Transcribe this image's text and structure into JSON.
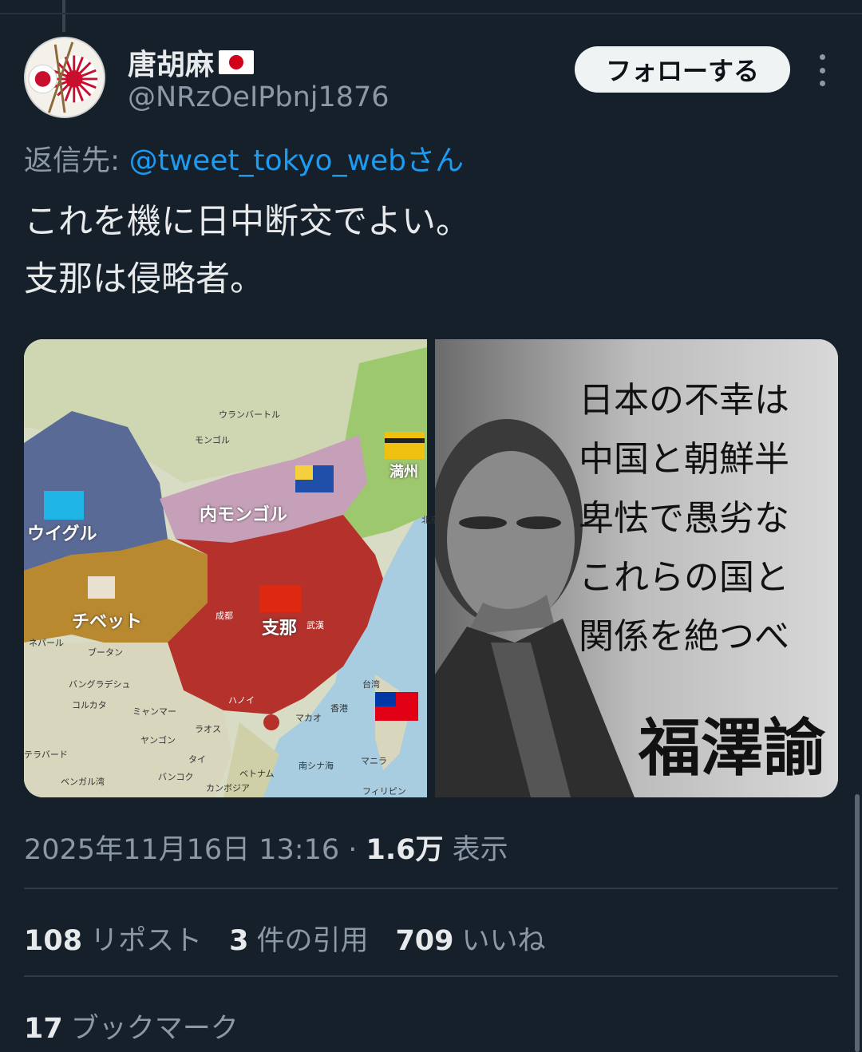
{
  "author": {
    "display_name": "唐胡麻",
    "handle": "@NRzOeIPbnj1876",
    "flag_emoji": "japan-flag"
  },
  "follow_button": {
    "label": "フォローする"
  },
  "reply_to": {
    "prefix": "返信先: ",
    "mention": "@tweet_tokyo_web",
    "suffix": "さん"
  },
  "tweet": {
    "lines": [
      "これを機に日中断交でよい。",
      "支那は侵略者。"
    ]
  },
  "media": {
    "map": {
      "labels": {
        "ulaanbaatar": "ウランバートル",
        "mongolia": "モンゴル",
        "inner_mongolia": "内モンゴル",
        "manchuria": "満州",
        "uyghur": "ウイグル",
        "tibet": "チベット",
        "china": "支那",
        "nepal": "ネパール",
        "bhutan": "ブータン",
        "bangladesh": "バングラデシュ",
        "kolkata": "コルカタ",
        "myanmar": "ミャンマー",
        "laos": "ラオス",
        "yangon": "ヤンゴン",
        "thailand": "タイ",
        "bangkok": "バンコク",
        "vietnam": "ベトナム",
        "cambodia": "カンボジア",
        "philippines": "フィリピン",
        "manila": "マニラ",
        "taiwan": "台湾",
        "south_china_sea": "南シナ海",
        "macau": "マカオ",
        "hong_kong": "香港",
        "chengdu": "成都",
        "wuhan": "武漢",
        "hanoi": "ハノイ",
        "bengal": "ベンガル湾",
        "hyderabad": "テラバード",
        "beijing": "北京"
      }
    },
    "quote": {
      "lines": [
        "日本の不幸は",
        "中国と朝鮮半",
        "卑怯で愚劣な",
        "これらの国と",
        "関係を絶つべ"
      ],
      "author": "福澤諭"
    }
  },
  "meta": {
    "datetime": "2025年11月16日 13:16",
    "separator": " · ",
    "views": "1.6万",
    "views_label": " 表示"
  },
  "stats": {
    "reposts_count": "108",
    "reposts_label": "リポスト",
    "quotes_count": "3",
    "quotes_label": "件の引用",
    "likes_count": "709",
    "likes_label": "いいね",
    "bookmarks_count": "17",
    "bookmarks_label": "ブックマーク"
  }
}
